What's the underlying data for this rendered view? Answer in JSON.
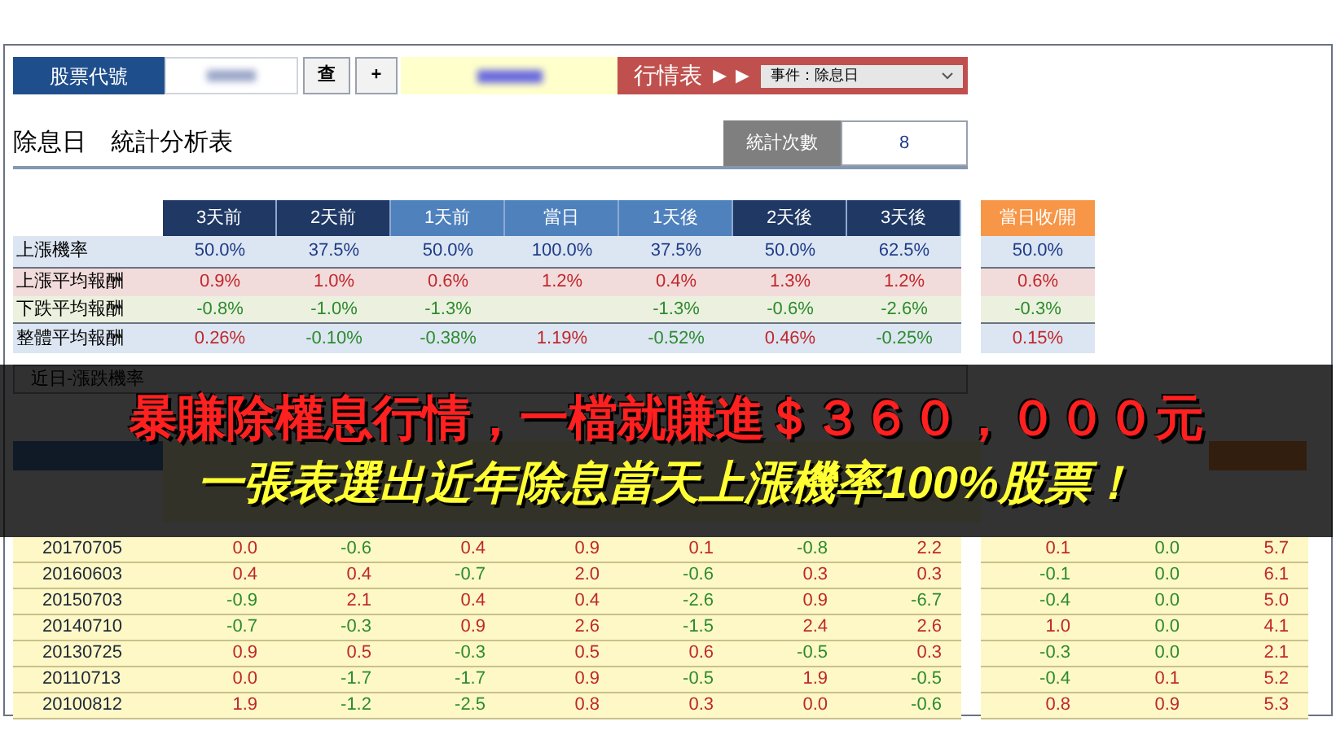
{
  "toolbar": {
    "stock_code_label": "股票代號",
    "search_button": "查",
    "add_button": "+",
    "quote_label": "行情表 ►►",
    "event_select": "事件：除息日"
  },
  "title": "除息日　統計分析表",
  "count": {
    "label": "統計次數",
    "value": "8"
  },
  "stats": {
    "columns": [
      {
        "label": "3天前",
        "color": "#1f3864"
      },
      {
        "label": "2天前",
        "color": "#1f3864"
      },
      {
        "label": "1天前",
        "color": "#4f81bd"
      },
      {
        "label": "當日",
        "color": "#4f81bd"
      },
      {
        "label": "1天後",
        "color": "#4f81bd"
      },
      {
        "label": "2天後",
        "color": "#1f3864"
      },
      {
        "label": "3天後",
        "color": "#1f3864"
      }
    ],
    "side_column": {
      "label": "當日收/開",
      "color": "#f79646"
    },
    "rows": [
      {
        "label": "上漲機率",
        "kind": "probability",
        "cells": [
          {
            "text": "50.0%"
          },
          {
            "text": "37.5%"
          },
          {
            "text": "50.0%"
          },
          {
            "text": "100.0%"
          },
          {
            "text": "37.5%"
          },
          {
            "text": "50.0%"
          },
          {
            "text": "62.5%"
          }
        ],
        "side": {
          "text": "50.0%"
        }
      },
      {
        "label": "上漲平均報酬",
        "kind": "gain",
        "cells": [
          {
            "text": "0.9%",
            "rising": true
          },
          {
            "text": "1.0%",
            "rising": true
          },
          {
            "text": "0.6%",
            "rising": true
          },
          {
            "text": "1.2%",
            "rising": true
          },
          {
            "text": "0.4%",
            "rising": true
          },
          {
            "text": "1.3%",
            "rising": true
          },
          {
            "text": "1.2%",
            "rising": true
          }
        ],
        "side": {
          "text": "0.6%",
          "rising": true
        }
      },
      {
        "label": "下跌平均報酬",
        "kind": "loss",
        "cells": [
          {
            "text": "-0.8%",
            "rising": false
          },
          {
            "text": "-1.0%",
            "rising": false
          },
          {
            "text": "-1.3%",
            "rising": false
          },
          null,
          {
            "text": "-1.3%",
            "rising": false
          },
          {
            "text": "-0.6%",
            "rising": false
          },
          {
            "text": "-2.6%",
            "rising": false
          }
        ],
        "side": {
          "text": "-0.3%",
          "rising": false
        }
      },
      {
        "label": "整體平均報酬",
        "kind": "overall",
        "cells": [
          {
            "text": "0.26%",
            "rising": true
          },
          {
            "text": "-0.10%",
            "rising": false
          },
          {
            "text": "-0.38%",
            "rising": false
          },
          {
            "text": "1.19%",
            "rising": true
          },
          {
            "text": "-0.52%",
            "rising": false
          },
          {
            "text": "0.46%",
            "rising": true
          },
          {
            "text": "-0.25%",
            "rising": false
          }
        ],
        "side": {
          "text": "0.15%",
          "rising": true
        }
      }
    ]
  },
  "recent": {
    "label": "近日-漲跌機率"
  },
  "history": {
    "rows": [
      {
        "date": "20170705",
        "cells": [
          {
            "text": "0.0",
            "rising": true
          },
          {
            "text": "-0.6",
            "rising": false
          },
          {
            "text": "0.4",
            "rising": true
          },
          {
            "text": "0.9",
            "rising": true
          },
          {
            "text": "0.1",
            "rising": true
          },
          {
            "text": "-0.8",
            "rising": false
          },
          {
            "text": "2.2",
            "rising": true
          }
        ],
        "side": [
          {
            "text": "0.1",
            "rising": true
          },
          {
            "text": "0.0",
            "rising": false
          },
          {
            "text": "5.7",
            "rising": true
          }
        ]
      },
      {
        "date": "20160603",
        "cells": [
          {
            "text": "0.4",
            "rising": true
          },
          {
            "text": "0.4",
            "rising": true
          },
          {
            "text": "-0.7",
            "rising": false
          },
          {
            "text": "2.0",
            "rising": true
          },
          {
            "text": "-0.6",
            "rising": false
          },
          {
            "text": "0.3",
            "rising": true
          },
          {
            "text": "0.3",
            "rising": true
          }
        ],
        "side": [
          {
            "text": "-0.1",
            "rising": false
          },
          {
            "text": "0.0",
            "rising": false
          },
          {
            "text": "6.1",
            "rising": true
          }
        ]
      },
      {
        "date": "20150703",
        "cells": [
          {
            "text": "-0.9",
            "rising": false
          },
          {
            "text": "2.1",
            "rising": true
          },
          {
            "text": "0.4",
            "rising": true
          },
          {
            "text": "0.4",
            "rising": true
          },
          {
            "text": "-2.6",
            "rising": false
          },
          {
            "text": "0.9",
            "rising": true
          },
          {
            "text": "-6.7",
            "rising": false
          }
        ],
        "side": [
          {
            "text": "-0.4",
            "rising": false
          },
          {
            "text": "0.0",
            "rising": false
          },
          {
            "text": "5.0",
            "rising": true
          }
        ]
      },
      {
        "date": "20140710",
        "cells": [
          {
            "text": "-0.7",
            "rising": false
          },
          {
            "text": "-0.3",
            "rising": false
          },
          {
            "text": "0.9",
            "rising": true
          },
          {
            "text": "2.6",
            "rising": true
          },
          {
            "text": "-1.5",
            "rising": false
          },
          {
            "text": "2.4",
            "rising": true
          },
          {
            "text": "2.6",
            "rising": true
          }
        ],
        "side": [
          {
            "text": "1.0",
            "rising": true
          },
          {
            "text": "0.0",
            "rising": false
          },
          {
            "text": "4.1",
            "rising": true
          }
        ]
      },
      {
        "date": "20130725",
        "cells": [
          {
            "text": "0.9",
            "rising": true
          },
          {
            "text": "0.5",
            "rising": true
          },
          {
            "text": "-0.3",
            "rising": false
          },
          {
            "text": "0.5",
            "rising": true
          },
          {
            "text": "0.6",
            "rising": true
          },
          {
            "text": "-0.5",
            "rising": false
          },
          {
            "text": "0.3",
            "rising": true
          }
        ],
        "side": [
          {
            "text": "-0.3",
            "rising": false
          },
          {
            "text": "0.0",
            "rising": false
          },
          {
            "text": "2.1",
            "rising": true
          }
        ]
      },
      {
        "date": "20110713",
        "cells": [
          {
            "text": "0.0",
            "rising": true
          },
          {
            "text": "-1.7",
            "rising": false
          },
          {
            "text": "-1.7",
            "rising": false
          },
          {
            "text": "0.9",
            "rising": true
          },
          {
            "text": "-0.5",
            "rising": false
          },
          {
            "text": "1.9",
            "rising": true
          },
          {
            "text": "-0.5",
            "rising": false
          }
        ],
        "side": [
          {
            "text": "-0.4",
            "rising": false
          },
          {
            "text": "0.1",
            "rising": true
          },
          {
            "text": "5.2",
            "rising": true
          }
        ]
      },
      {
        "date": "20100812",
        "cells": [
          {
            "text": "1.9",
            "rising": true
          },
          {
            "text": "-1.2",
            "rising": false
          },
          {
            "text": "-2.5",
            "rising": false
          },
          {
            "text": "0.8",
            "rising": true
          },
          {
            "text": "0.3",
            "rising": true
          },
          {
            "text": "0.0",
            "rising": true
          },
          {
            "text": "-0.6",
            "rising": false
          }
        ],
        "side": [
          {
            "text": "0.8",
            "rising": true
          },
          {
            "text": "0.9",
            "rising": true
          },
          {
            "text": "5.3",
            "rising": true
          }
        ]
      }
    ]
  },
  "banner": {
    "headline": "暴賺除權息行情，一檔就賺進＄３６０，０００元",
    "subline": "一張表選出近年除息當天上漲機率100%股票！"
  }
}
